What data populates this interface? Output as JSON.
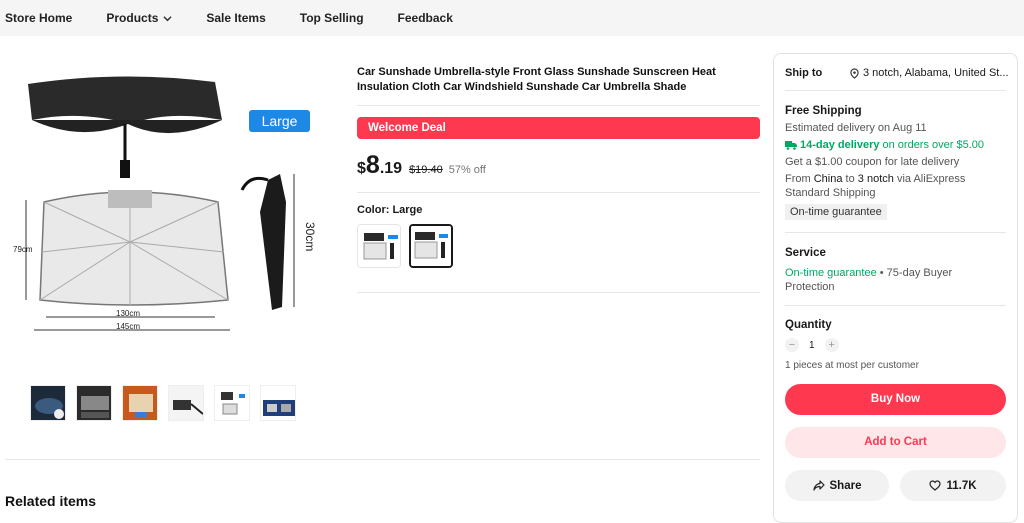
{
  "nav": {
    "items": [
      "Store Home",
      "Products",
      "Sale Items",
      "Top Selling",
      "Feedback"
    ]
  },
  "gallery": {
    "badge": "Large",
    "dim_height": "79cm",
    "dim_width_inner": "130cm",
    "dim_width_outer": "145cm",
    "dim_folded": "30cm"
  },
  "product": {
    "title": "Car Sunshade Umbrella-style Front Glass Sunshade Sunscreen Heat Insulation Cloth Car Windshield Sunshade Car Umbrella Shade",
    "deal_label": "Welcome Deal",
    "currency": "$",
    "price_int": "8",
    "price_dec": ".19",
    "original_price": "$19.40",
    "discount": "57% off",
    "color_label": "Color: Large"
  },
  "related_title": "Related items",
  "panel": {
    "ship_to_label": "Ship to",
    "ship_to_value": "3 notch, Alabama, United St...",
    "free_shipping": "Free Shipping",
    "estimated": "Estimated delivery on Aug 11",
    "fast_delivery": "14-day delivery",
    "fast_delivery_suffix": "on orders over $5.00",
    "coupon": "Get a $1.00 coupon for late delivery",
    "from_prefix": "From",
    "from_origin": "China",
    "from_to": "to",
    "from_dest": "3 notch",
    "from_suffix": "via AliExpress",
    "standard": "Standard Shipping",
    "ontime_tag": "On-time guarantee",
    "service_title": "Service",
    "service_green": "On-time guarantee",
    "service_rest": " • 75-day Buyer",
    "service_rest2": "Protection",
    "quantity_title": "Quantity",
    "quantity_value": "1",
    "limit": "1 pieces at most per customer",
    "buy_now": "Buy Now",
    "add_to_cart": "Add to Cart",
    "share": "Share",
    "wishlist_count": "11.7K"
  },
  "colors": {
    "accent": "#fd384f",
    "cart_bg": "#ffe6e9",
    "green": "#00a862",
    "badge_blue": "#1e88e5"
  }
}
